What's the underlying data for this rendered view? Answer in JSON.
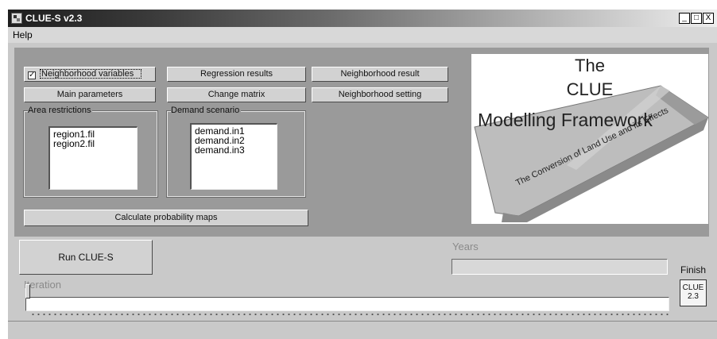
{
  "window": {
    "title": "CLUE-S v2.3"
  },
  "controls": {
    "minimize": "_",
    "maximize": "□",
    "close": "X"
  },
  "menu": {
    "help": "Help"
  },
  "options": {
    "neighborhood_variables_label": "Neighborhood variables",
    "neighborhood_variables_checked": true,
    "check_mark": "✓"
  },
  "buttons": {
    "regression_results": "Regression results",
    "neighborhood_result": "Neighborhood result",
    "main_parameters": "Main parameters",
    "change_matrix": "Change matrix",
    "neighborhood_setting": "Neighborhood setting",
    "calculate_probability_maps": "Calculate probability maps",
    "run_clue_s": "Run CLUE-S"
  },
  "area_restrictions": {
    "label": "Area restrictions",
    "items": [
      "region1.fil",
      "region2.fil"
    ]
  },
  "demand_scenario": {
    "label": "Demand scenario",
    "items": [
      "demand.in1",
      "demand.in2",
      "demand.in3"
    ]
  },
  "logo": {
    "line1": "The",
    "line2": "CLUE",
    "line3": "Modelling Framework",
    "band_text": "The Conversion of Land Use and its Effects"
  },
  "progress": {
    "years_label": "Years",
    "years_fraction": 0,
    "finish_label": "Finish",
    "iteration_label": "Iteration",
    "iteration_fraction": 0
  },
  "icon": {
    "line1": "CLUE",
    "line2": "2.3"
  }
}
